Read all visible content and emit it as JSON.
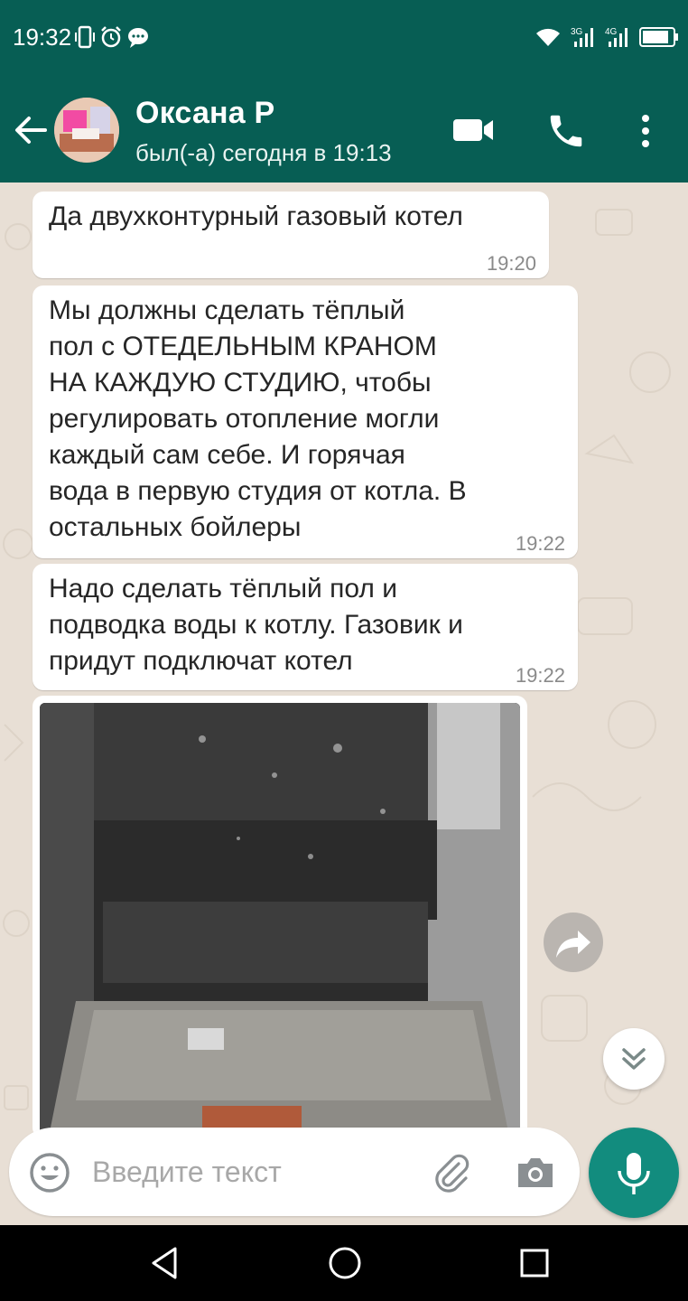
{
  "status_bar": {
    "time": "19:32",
    "left_icons": [
      "vibrate-icon",
      "alarm-icon",
      "chat-notification-icon"
    ],
    "right_icons": [
      "wifi-icon",
      "signal-3g-icon",
      "signal-4g-icon",
      "battery-icon"
    ],
    "signal_3g_label": "3G",
    "signal_4g_label": "4G"
  },
  "header": {
    "contact_name": "Оксана Р",
    "last_seen": "был(-а) сегодня в 19:13",
    "colors": {
      "background": "#075e54"
    }
  },
  "messages": [
    {
      "text": "Да двухконтурный газовый котел",
      "time": "19:20"
    },
    {
      "text": "Мы должны сделать тёплый\nпол с ОТЕДЕЛЬНЫМ КРАНОМ\nНА КАЖДУЮ СТУДИЮ, чтобы\nрегулировать отопление могли\nкаждый сам себе. И горячая\nвода в первую студия от котла. В\nостальных бойлеры",
      "time": "19:22"
    },
    {
      "text": "Надо сделать тёплый пол и\nподводка воды к котлу. Газовик и\nпридут подключат котел",
      "time": "19:22"
    }
  ],
  "input": {
    "placeholder": "Введите текст"
  },
  "colors": {
    "chat_background": "#e8dfd5",
    "bubble": "#ffffff",
    "accent": "#128c7e"
  }
}
